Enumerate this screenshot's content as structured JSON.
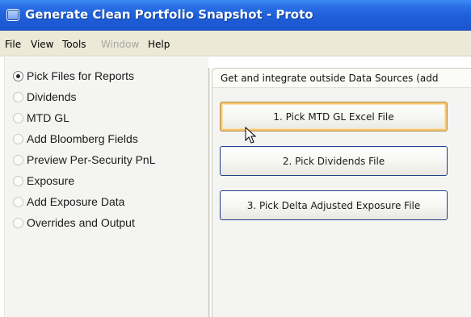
{
  "window": {
    "title": "Generate Clean Portfolio Snapshot  - Proto"
  },
  "menu": {
    "items": [
      {
        "label": "File",
        "enabled": true
      },
      {
        "label": "View",
        "enabled": true
      },
      {
        "label": "Tools",
        "enabled": true
      },
      {
        "label": "Window",
        "enabled": false
      },
      {
        "label": "Help",
        "enabled": true
      }
    ]
  },
  "sidebar": {
    "items": [
      {
        "label": "Pick Files for Reports",
        "selected": true
      },
      {
        "label": "Dividends",
        "selected": false
      },
      {
        "label": "MTD GL",
        "selected": false
      },
      {
        "label": "Add Bloomberg Fields",
        "selected": false
      },
      {
        "label": "Preview Per-Security PnL",
        "selected": false
      },
      {
        "label": "Exposure",
        "selected": false
      },
      {
        "label": "Add Exposure Data",
        "selected": false
      },
      {
        "label": "Overrides and Output",
        "selected": false
      }
    ]
  },
  "panel": {
    "header": "Get and integrate outside Data Sources (add",
    "buttons": [
      {
        "label": "1. Pick MTD GL Excel File",
        "focused": true
      },
      {
        "label": "2. Pick Dividends File",
        "focused": false
      },
      {
        "label": "3. Pick Delta Adjusted Exposure File",
        "focused": false
      }
    ]
  },
  "colors": {
    "titlebar": "#2a6fe6",
    "menubar": "#ece9d8",
    "focus_ring": "#f6c774",
    "button_border": "#1e3f86"
  },
  "icons": {
    "app": "app-window-icon",
    "cursor": "mouse-pointer-icon"
  }
}
